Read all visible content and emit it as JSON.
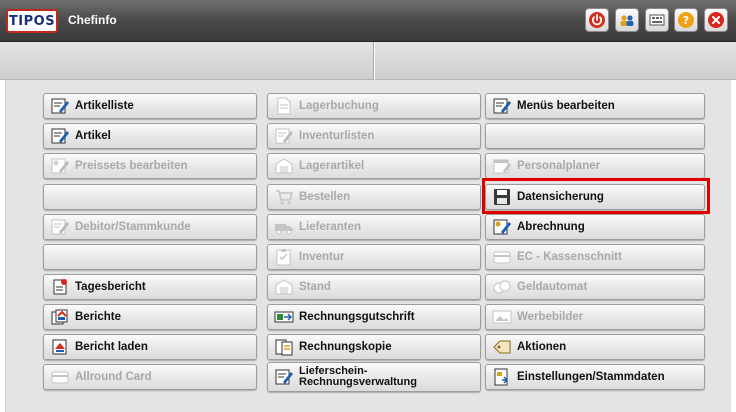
{
  "window": {
    "logo": "TIPOS",
    "title": "Chefinfo",
    "toolbar": [
      {
        "icon": "power-icon",
        "color": "#d32f1f"
      },
      {
        "icon": "users-icon",
        "color": "#e0a21b"
      },
      {
        "icon": "keyboard-icon",
        "color": "#444444"
      },
      {
        "icon": "help-icon",
        "color": "#f0a114"
      },
      {
        "icon": "close-icon",
        "color": "#d8281c"
      }
    ]
  },
  "menu": {
    "col1": [
      {
        "label": "Artikelliste",
        "enabled": true,
        "icon": "edit-icon"
      },
      {
        "label": "Artikel",
        "enabled": true,
        "icon": "edit-icon"
      },
      {
        "label": "Preissets bearbeiten",
        "enabled": false,
        "icon": "price-edit-icon"
      },
      {
        "label": "",
        "enabled": true,
        "icon": ""
      },
      {
        "label": "Debitor/Stammkunde",
        "enabled": false,
        "icon": "edit-icon"
      },
      {
        "label": "",
        "enabled": true,
        "icon": ""
      },
      {
        "label": "Tagesbericht",
        "enabled": true,
        "icon": "report-icon"
      },
      {
        "label": "Berichte",
        "enabled": true,
        "icon": "reports-icon"
      },
      {
        "label": "Bericht laden",
        "enabled": true,
        "icon": "report-load-icon"
      },
      {
        "label": "Allround Card",
        "enabled": false,
        "icon": "card-icon"
      }
    ],
    "col2": [
      {
        "label": "Lagerbuchung",
        "enabled": false,
        "icon": "document-icon"
      },
      {
        "label": "Inventurlisten",
        "enabled": false,
        "icon": "edit-icon"
      },
      {
        "label": "Lagerartikel",
        "enabled": false,
        "icon": "warehouse-icon"
      },
      {
        "label": "Bestellen",
        "enabled": false,
        "icon": "cart-icon"
      },
      {
        "label": "Lieferanten",
        "enabled": false,
        "icon": "truck-icon"
      },
      {
        "label": "Inventur",
        "enabled": false,
        "icon": "clipboard-icon"
      },
      {
        "label": "Stand",
        "enabled": false,
        "icon": "warehouse-icon"
      },
      {
        "label": "Rechnungsgutschrift",
        "enabled": true,
        "icon": "credit-note-icon"
      },
      {
        "label": "Rechnungskopie",
        "enabled": true,
        "icon": "invoice-copy-icon"
      },
      {
        "label": "Lieferschein-",
        "label2": "Rechnungsverwaltung",
        "enabled": true,
        "icon": "edit-icon"
      }
    ],
    "col3": [
      {
        "label": "Menüs bearbeiten",
        "enabled": true,
        "icon": "edit-icon"
      },
      {
        "label": "",
        "enabled": true,
        "icon": ""
      },
      {
        "label": "Personalplaner",
        "enabled": false,
        "icon": "planner-icon"
      },
      {
        "label": "Datensicherung",
        "enabled": true,
        "icon": "save-icon"
      },
      {
        "label": "Abrechnung",
        "enabled": true,
        "icon": "price-edit-icon"
      },
      {
        "label": "EC - Kassenschnitt",
        "enabled": false,
        "icon": "card-reader-icon"
      },
      {
        "label": "Geldautomat",
        "enabled": false,
        "icon": "coins-icon"
      },
      {
        "label": "Werbebilder",
        "enabled": false,
        "icon": "picture-icon"
      },
      {
        "label": "Aktionen",
        "enabled": true,
        "icon": "tag-icon"
      },
      {
        "label": "Einstellungen/Stammdaten",
        "enabled": true,
        "icon": "settings-doc-icon"
      }
    ]
  }
}
